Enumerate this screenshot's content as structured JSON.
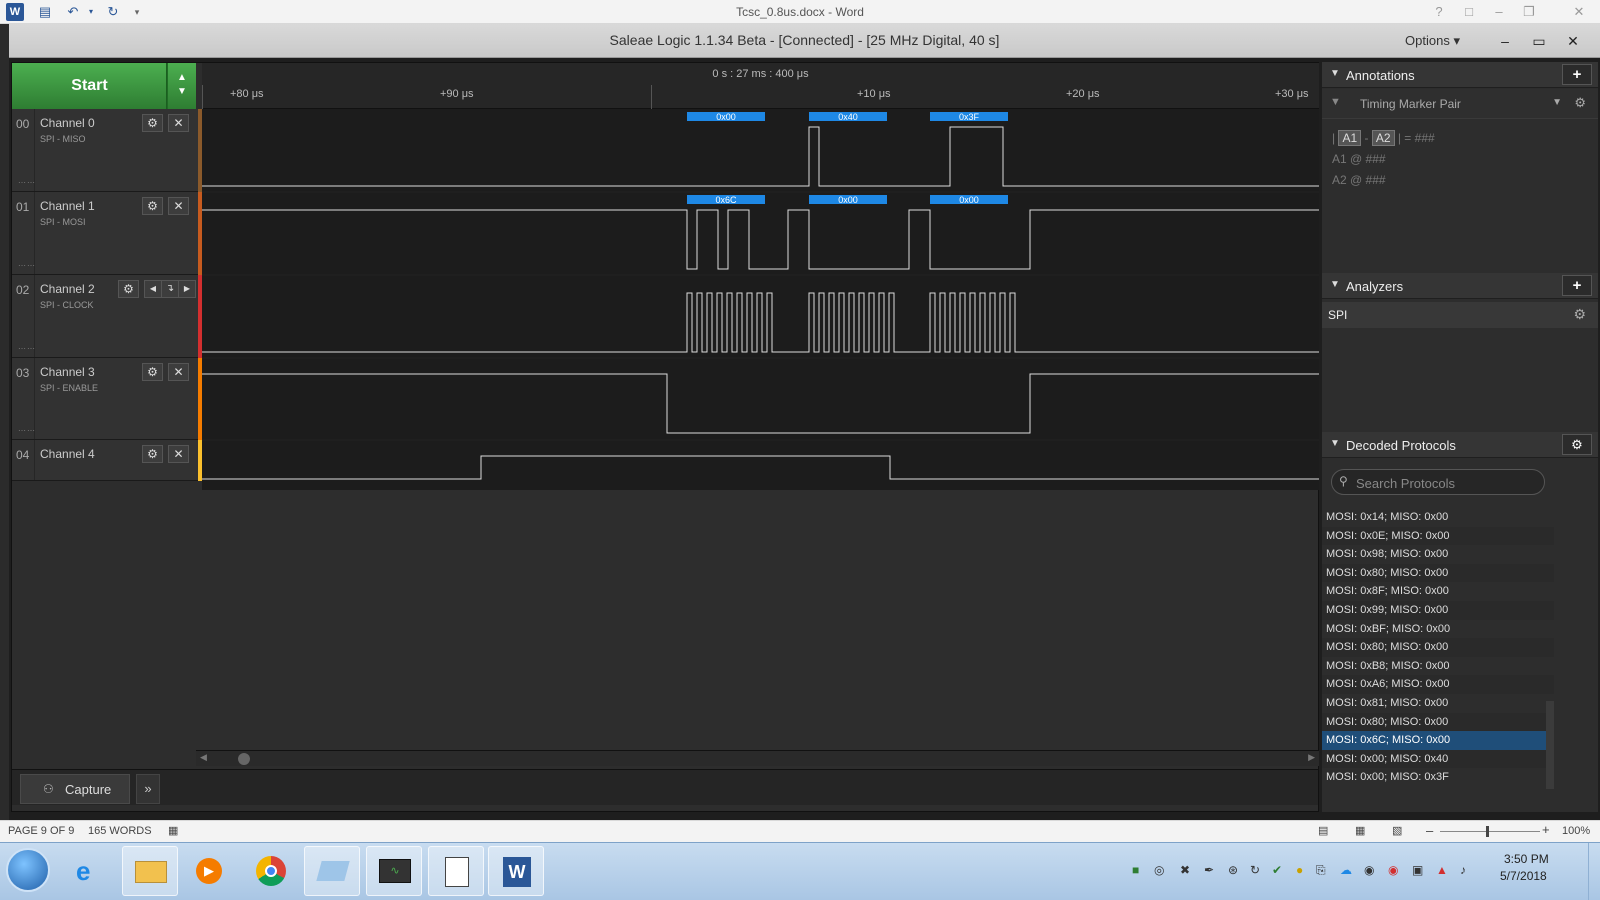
{
  "word": {
    "title": "Tcsc_0.8us.docx - Word",
    "help": "?",
    "status_page": "PAGE 9 OF 9",
    "status_words": "165 WORDS",
    "zoom": "100%"
  },
  "saleae": {
    "title": "Saleae Logic 1.1.34 Beta - [Connected] - [25 MHz Digital, 40 s]",
    "options_label": "Options ▾",
    "start_label": "Start",
    "ruler": {
      "center": "0 s : 27 ms : 400 μs",
      "ticks": [
        "+80 μs",
        "+90 μs",
        "+10 μs",
        "+20 μs",
        "+30 μs"
      ]
    },
    "channels": [
      {
        "num": "00",
        "name": "Channel 0",
        "sub": "SPI - MISO",
        "color": "#8b5a2b"
      },
      {
        "num": "01",
        "name": "Channel 1",
        "sub": "SPI - MOSI",
        "color": "#c75b1f"
      },
      {
        "num": "02",
        "name": "Channel 2",
        "sub": "SPI - CLOCK",
        "color": "#d32f2f"
      },
      {
        "num": "03",
        "name": "Channel 3",
        "sub": "SPI - ENABLE",
        "color": "#f57c00"
      },
      {
        "num": "04",
        "name": "Channel 4",
        "sub": "",
        "color": "#fbc02d"
      }
    ],
    "decoded_labels": {
      "miso": [
        "0x00",
        "0x40",
        "0x3F"
      ],
      "mosi": [
        "0x6C",
        "0x00",
        "0x00"
      ]
    },
    "capture_label": "Capture",
    "annotations": {
      "title": "Annotations",
      "marker_pair": "Timing Marker Pair",
      "formula_rest": "= ###",
      "a1_label": "A1",
      "a2_label": "A2",
      "a1_value": "@ ###",
      "a2_value": "@ ###"
    },
    "analyzers": {
      "title": "Analyzers",
      "items": [
        "SPI"
      ]
    },
    "decoded_protocols": {
      "title": "Decoded Protocols",
      "search_placeholder": "Search Protocols",
      "items": [
        "MOSI: 0x14;  MISO: 0x00",
        "MOSI: 0x0E;  MISO: 0x00",
        "MOSI: 0x98;  MISO: 0x00",
        "MOSI: 0x80;  MISO: 0x00",
        "MOSI: 0x8F;  MISO: 0x00",
        "MOSI: 0x99;  MISO: 0x00",
        "MOSI: 0xBF;  MISO: 0x00",
        "MOSI: 0x80;  MISO: 0x00",
        "MOSI: 0xB8;  MISO: 0x00",
        "MOSI: 0xA6;  MISO: 0x00",
        "MOSI: 0x81;  MISO: 0x00",
        "MOSI: 0x80;  MISO: 0x00",
        "MOSI: 0x6C;  MISO: 0x00",
        "MOSI: 0x00;  MISO: 0x40",
        "MOSI: 0x00;  MISO: 0x3F"
      ],
      "selected_index": 12
    }
  },
  "taskbar": {
    "time": "3:50 PM",
    "date": "5/7/2018"
  },
  "colors": {
    "accent_green": "#2e7d32",
    "decode_blue": "#1e88e5",
    "selection_blue": "#1f4e79"
  }
}
